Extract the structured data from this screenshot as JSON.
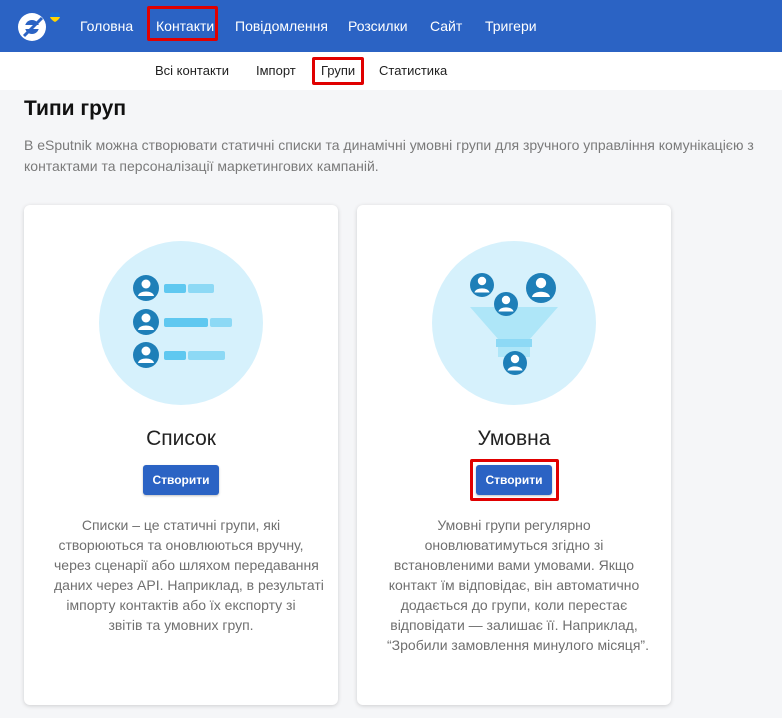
{
  "topnav": {
    "items": [
      {
        "label": "Головна",
        "name": "home"
      },
      {
        "label": "Контакти",
        "name": "contacts"
      },
      {
        "label": "Повідомлення",
        "name": "messages"
      },
      {
        "label": "Розсилки",
        "name": "campaigns"
      },
      {
        "label": "Сайт",
        "name": "site"
      },
      {
        "label": "Тригери",
        "name": "triggers"
      }
    ]
  },
  "subnav": {
    "items": [
      {
        "label": "Всі контакти",
        "name": "all-contacts"
      },
      {
        "label": "Імпорт",
        "name": "import"
      },
      {
        "label": "Групи",
        "name": "groups"
      },
      {
        "label": "Статистика",
        "name": "statistics"
      }
    ]
  },
  "page": {
    "title": "Типи груп",
    "intro": [
      "В eSputnik можна створювати статичні списки та динамічні умовні групи для зручного управління комунікацією з",
      "контактами та персоналізації маркетингових кампаній."
    ]
  },
  "cards": [
    {
      "title": "Список",
      "button": "Створити",
      "description": [
        "Списки – це статичні групи, які",
        "створюються та оновлюються вручну,",
        "через сценарії або шляхом передавання",
        "даних через API. Наприклад, в результаті",
        "імпорту контактів або їх експорту зі",
        "звітів та умовних груп."
      ]
    },
    {
      "title": "Умовна",
      "button": "Створити",
      "description": [
        "Умовні групи регулярно",
        "оновлюватимуться згідно зі",
        "встановленими вами умовами. Якщо",
        "контакт їм відповідає, він автоматично",
        "додається до групи, коли перестає",
        "відповідати — залишає її. Наприклад,",
        "“Зробили замовлення минулого місяця”."
      ]
    }
  ],
  "colors": {
    "brand": "#2b63c4",
    "highlight": "#e00000",
    "illustration_bg": "#d6f1fc"
  }
}
